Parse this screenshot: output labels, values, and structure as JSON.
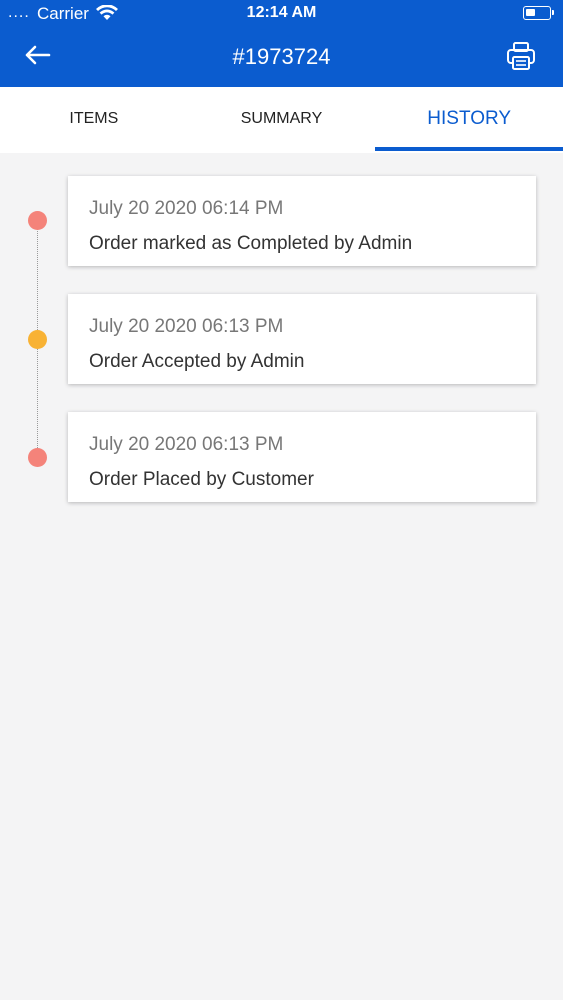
{
  "status_bar": {
    "signal": "....",
    "carrier": "Carrier",
    "time": "12:14 AM"
  },
  "header": {
    "title": "#1973724",
    "background": "#0b5ccf",
    "back_icon": "arrow-left-icon",
    "print_icon": "printer-icon"
  },
  "tabs": [
    {
      "label": "ITEMS",
      "active": false
    },
    {
      "label": "SUMMARY",
      "active": false
    },
    {
      "label": "HISTORY",
      "active": true
    }
  ],
  "history": [
    {
      "date": "July 20 2020 06:14 PM",
      "event": "Order marked as Completed by Admin",
      "dot_color": "#f4837a"
    },
    {
      "date": "July 20 2020 06:13 PM",
      "event": "Order Accepted by Admin",
      "dot_color": "#f8b234"
    },
    {
      "date": "July 20 2020 06:13 PM",
      "event": "Order Placed by Customer",
      "dot_color": "#f4837a"
    }
  ]
}
